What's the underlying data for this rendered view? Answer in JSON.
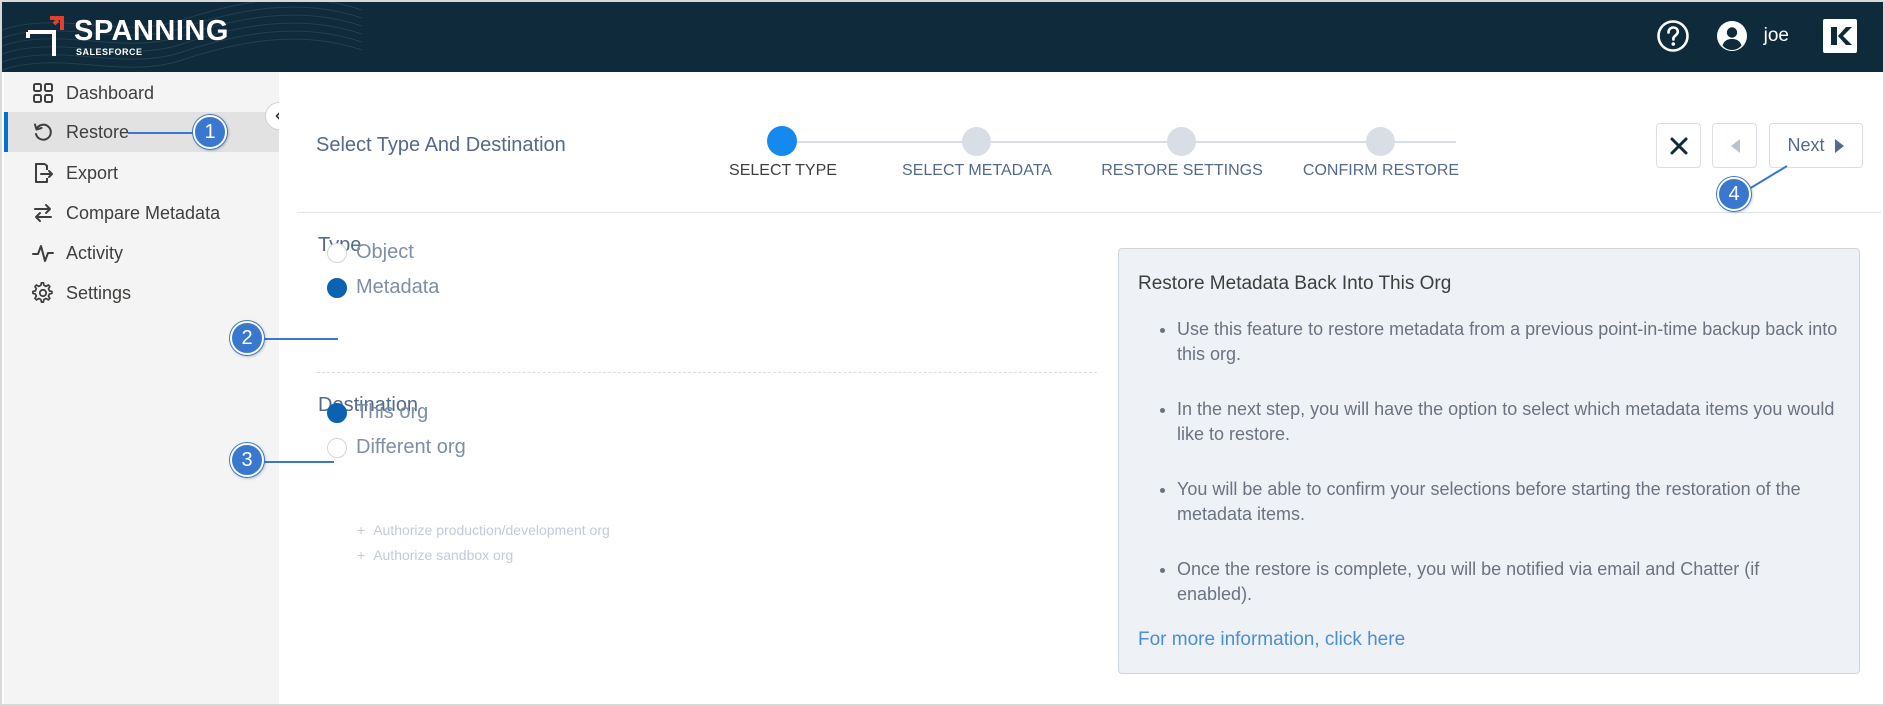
{
  "header": {
    "brand_title": "SPANNING",
    "brand_subtitle": "SALESFORCE",
    "user_name": "joe",
    "icons": [
      "help-icon",
      "user-avatar-icon",
      "kaseya-brand-icon"
    ]
  },
  "sidebar": {
    "items": [
      {
        "label": "Dashboard",
        "icon": "grid-icon"
      },
      {
        "label": "Restore",
        "icon": "restore-icon",
        "active": true
      },
      {
        "label": "Export",
        "icon": "export-icon"
      },
      {
        "label": "Compare Metadata",
        "icon": "compare-arrows-icon"
      },
      {
        "label": "Activity",
        "icon": "activity-pulse-icon"
      },
      {
        "label": "Settings",
        "icon": "gear-icon"
      }
    ]
  },
  "wizard": {
    "title": "Select Type And Destination",
    "steps": [
      {
        "label": "SELECT TYPE",
        "active": true
      },
      {
        "label": "SELECT METADATA",
        "active": false
      },
      {
        "label": "RESTORE SETTINGS",
        "active": false
      },
      {
        "label": "CONFIRM RESTORE",
        "active": false
      }
    ],
    "next_label": "Next"
  },
  "form": {
    "type_label": "Type",
    "type_options": [
      {
        "label": "Object",
        "checked": false
      },
      {
        "label": "Metadata",
        "checked": true
      }
    ],
    "destination_label": "Destination",
    "destination_options": [
      {
        "label": "This org",
        "checked": true
      },
      {
        "label": "Different org",
        "checked": false
      }
    ],
    "authorize_links": [
      "Authorize production/development org",
      "Authorize sandbox org"
    ]
  },
  "info": {
    "title": "Restore Metadata Back Into This Org",
    "bullets": [
      "Use this feature to restore metadata from a previous point-in-time backup back into this org.",
      "In the next step, you will have the option to select which metadata items you would like to restore.",
      "You will be able to confirm your selections before starting the restoration of the metadata items.",
      "Once the restore is complete, you will be notified via email and Chatter (if enabled)."
    ],
    "link": "For more information, click here"
  },
  "callouts": [
    "1",
    "2",
    "3",
    "4"
  ],
  "colors": {
    "header_bg": "#0f2a3a",
    "accent": "#1589ee",
    "radio_checked": "#0a62b0",
    "callout": "#3a78d0",
    "logo_red": "#e2402d"
  }
}
